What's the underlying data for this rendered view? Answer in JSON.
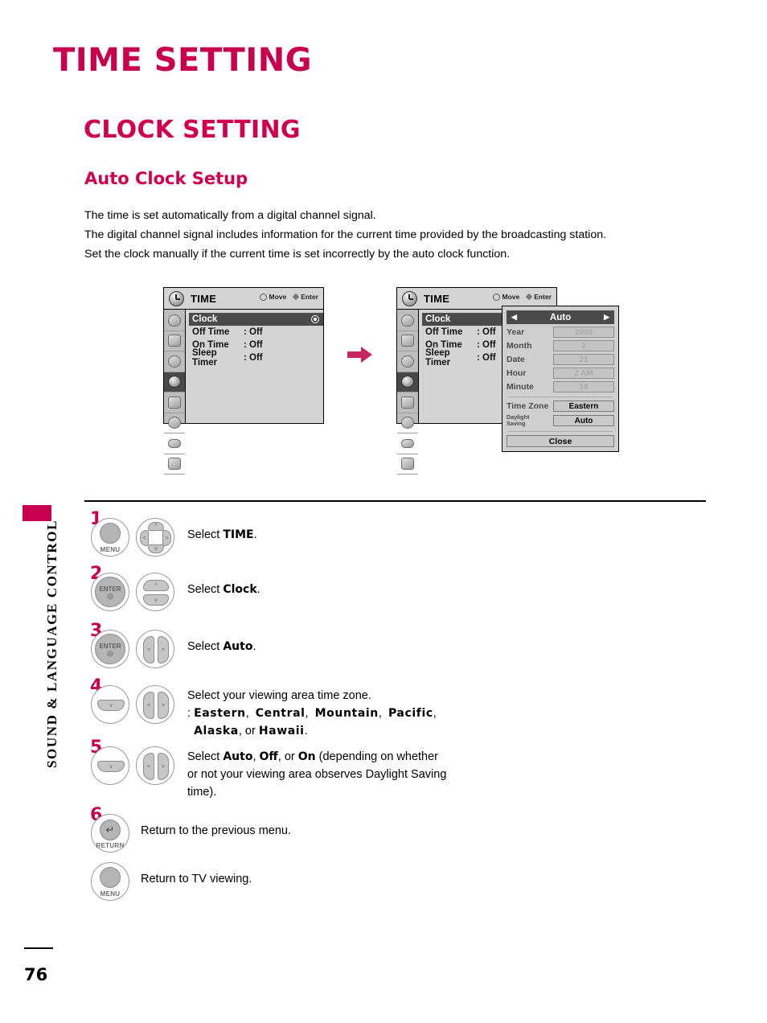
{
  "side_tab": {
    "label": "SOUND & LANGUAGE CONTROL"
  },
  "headings": {
    "h1": "TIME SETTING",
    "h2": "CLOCK SETTING",
    "h3": "Auto Clock Setup"
  },
  "intro": {
    "line1": "The time is set automatically from a digital channel signal.",
    "line2": "The digital channel signal includes information for the current time provided by the broadcasting station.",
    "line3": "Set the clock manually if the current time is set incorrectly by the auto clock function."
  },
  "osd": {
    "title": "TIME",
    "hint_move": "Move",
    "hint_enter": "Enter",
    "rows": [
      {
        "label": "Clock",
        "value": ""
      },
      {
        "label": "Off Time",
        "value": ": Off"
      },
      {
        "label": "On Time",
        "value": ": Off"
      },
      {
        "label": "Sleep Timer",
        "value": ": Off"
      }
    ],
    "sidebar_icons": [
      "picture-icon",
      "screen-icon",
      "audio-icon",
      "time-icon",
      "option-icon",
      "lock-icon",
      "input-icon",
      "usb-icon"
    ]
  },
  "popup": {
    "header": "Auto",
    "arrow_left": "◀",
    "arrow_right": "▶",
    "fields": [
      {
        "label": "Year",
        "value": "2008"
      },
      {
        "label": "Month",
        "value": "2"
      },
      {
        "label": "Date",
        "value": "21"
      },
      {
        "label": "Hour",
        "value": "2 AM"
      },
      {
        "label": "Minute",
        "value": "10"
      }
    ],
    "time_zone_label": "Time Zone",
    "time_zone_value": "Eastern",
    "daylight_label_1": "Daylight",
    "daylight_label_2": "Saving",
    "daylight_value": "Auto",
    "close_label": "Close"
  },
  "steps": [
    {
      "num": "1",
      "button_caption": "MENU",
      "pad": "4way",
      "text_prefix": "Select ",
      "text_bold": "TIME",
      "text_suffix": "."
    },
    {
      "num": "2",
      "button_caption": "ENTER",
      "pad": "updown",
      "text_prefix": "Select ",
      "text_bold": "Clock",
      "text_suffix": "."
    },
    {
      "num": "3",
      "button_caption": "ENTER",
      "pad": "leftright",
      "text_prefix": "Select ",
      "text_bold": "Auto",
      "text_suffix": "."
    },
    {
      "num": "4",
      "button_caption": "",
      "pad": "leftright",
      "line1": "Select your viewing area time zone.",
      "line2_prefix": ": ",
      "zones": [
        "Eastern",
        "Central",
        "Mountain",
        "Pacific",
        "Alaska",
        "Hawaii"
      ],
      "zones_or": ", or ",
      "zones_end": "."
    },
    {
      "num": "5",
      "button_caption": "",
      "pad": "leftright",
      "l_pre": "Select ",
      "l_b1": "Auto",
      "l_s1": ", ",
      "l_b2": "Off",
      "l_s2": ", or ",
      "l_b3": "On",
      "l_tail": " (depending on whether",
      "line2": "or not your viewing area observes Daylight Saving",
      "line3": "time)."
    },
    {
      "num": "6",
      "button_caption": "RETURN",
      "text": "Return to the previous menu."
    },
    {
      "num": "",
      "button_caption": "MENU",
      "text": "Return to TV viewing."
    }
  ],
  "footer": {
    "page_number": "76"
  },
  "colors": {
    "accent": "#c9004e",
    "heading2": "#d1004f",
    "osd_selected": "#4a4a4a"
  }
}
